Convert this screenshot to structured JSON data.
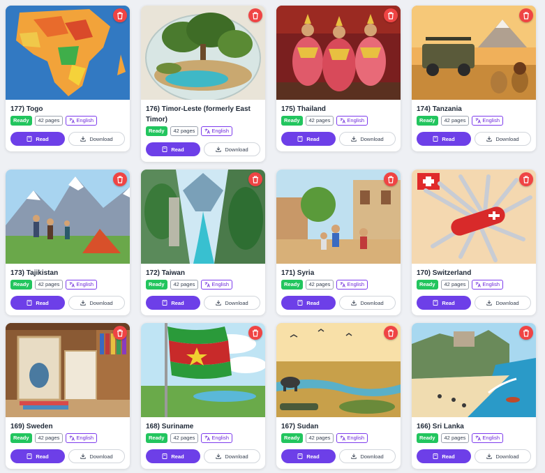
{
  "books": [
    {
      "title": "177) Togo",
      "status": "Ready",
      "pages": "42 pages",
      "language": "English",
      "read_label": "Read",
      "download_label": "Download"
    },
    {
      "title": "176) Timor-Leste (formerly East Timor)",
      "status": "Ready",
      "pages": "42 pages",
      "language": "English",
      "read_label": "Read",
      "download_label": "Download"
    },
    {
      "title": "175) Thailand",
      "status": "Ready",
      "pages": "42 pages",
      "language": "English",
      "read_label": "Read",
      "download_label": "Download"
    },
    {
      "title": "174) Tanzania",
      "status": "Ready",
      "pages": "42 pages",
      "language": "English",
      "read_label": "Read",
      "download_label": "Download"
    },
    {
      "title": "173) Tajikistan",
      "status": "Ready",
      "pages": "42 pages",
      "language": "English",
      "read_label": "Read",
      "download_label": "Download"
    },
    {
      "title": "172) Taiwan",
      "status": "Ready",
      "pages": "42 pages",
      "language": "English",
      "read_label": "Read",
      "download_label": "Download"
    },
    {
      "title": "171) Syria",
      "status": "Ready",
      "pages": "42 pages",
      "language": "English",
      "read_label": "Read",
      "download_label": "Download"
    },
    {
      "title": "170) Switzerland",
      "status": "Ready",
      "pages": "42 pages",
      "language": "English",
      "read_label": "Read",
      "download_label": "Download"
    },
    {
      "title": "169) Sweden",
      "status": "Ready",
      "pages": "42 pages",
      "language": "English",
      "read_label": "Read",
      "download_label": "Download"
    },
    {
      "title": "168) Suriname",
      "status": "Ready",
      "pages": "42 pages",
      "language": "English",
      "read_label": "Read",
      "download_label": "Download"
    },
    {
      "title": "167) Sudan",
      "status": "Ready",
      "pages": "42 pages",
      "language": "English",
      "read_label": "Read",
      "download_label": "Download"
    },
    {
      "title": "166) Sri Lanka",
      "status": "Ready",
      "pages": "42 pages",
      "language": "English",
      "read_label": "Read",
      "download_label": "Download"
    }
  ],
  "colors": {
    "accent": "#6d3fe8",
    "ready": "#22c55e",
    "delete": "#ef4444",
    "language_border": "#7c3aed"
  },
  "icons": {
    "delete": "trash-icon",
    "language": "translate-icon",
    "read": "book-icon",
    "download": "download-icon"
  }
}
